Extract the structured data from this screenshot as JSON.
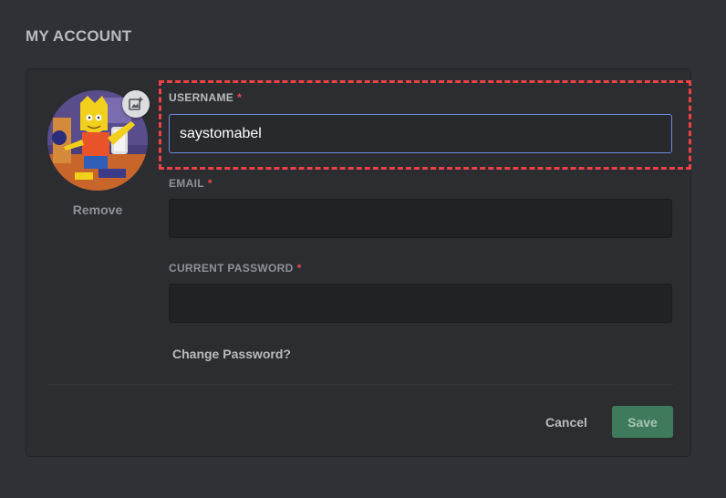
{
  "page": {
    "title": "MY ACCOUNT"
  },
  "avatar": {
    "remove_label": "Remove",
    "upload_icon": "image-upload-icon"
  },
  "fields": {
    "username": {
      "label": "USERNAME",
      "required_mark": "*",
      "value": "saystomabel"
    },
    "email": {
      "label": "EMAIL",
      "required_mark": "*",
      "value": ""
    },
    "password": {
      "label": "CURRENT PASSWORD",
      "required_mark": "*",
      "value": ""
    }
  },
  "links": {
    "change_password": "Change Password?"
  },
  "actions": {
    "cancel_label": "Cancel",
    "save_label": "Save"
  },
  "colors": {
    "background": "#2f3136",
    "panel": "#2b2d31",
    "focus_border": "#7289da",
    "required": "#f04747",
    "highlight": "#ed4245",
    "save_button": "#3e7a5b"
  }
}
